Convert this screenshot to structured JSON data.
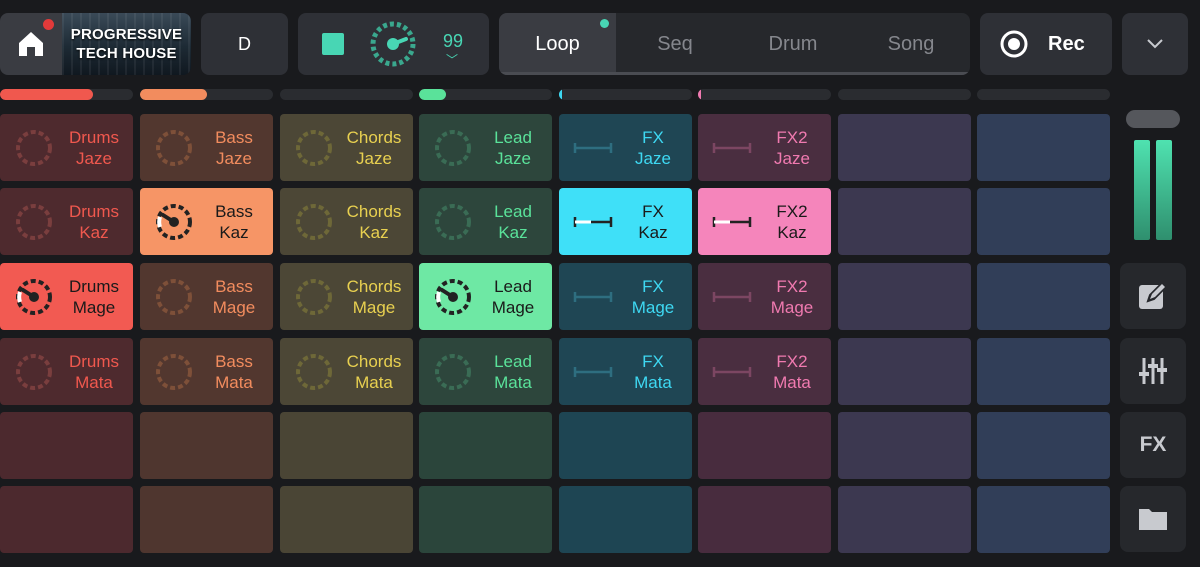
{
  "project": {
    "title_line1": "PROGRESSIVE",
    "title_line2": "TECH HOUSE"
  },
  "key": "D",
  "tempo": {
    "value": "99"
  },
  "tabs": [
    {
      "label": "Loop",
      "active": true
    },
    {
      "label": "Seq",
      "active": false
    },
    {
      "label": "Drum",
      "active": false
    },
    {
      "label": "Song",
      "active": false
    }
  ],
  "record": {
    "label": "Rec"
  },
  "sidebar": {
    "fx_label": "FX"
  },
  "lanes": [
    {
      "color": "#f0584e",
      "progress": 0.7
    },
    {
      "color": "#f28c5e",
      "progress": 0.5
    },
    {
      "color": "#d9c24a",
      "progress": 0
    },
    {
      "color": "#5ae29a",
      "progress": 0.2
    },
    {
      "color": "#3ed8f2",
      "progress": 0.01
    },
    {
      "color": "#f07ab0",
      "progress": 0.01
    },
    {
      "color": "#8a7ac8",
      "progress": 0
    },
    {
      "color": "#6a8ec8",
      "progress": 0
    }
  ],
  "columns": [
    {
      "name": "Drums",
      "icon": "dial",
      "color": "#f0584e",
      "idle_bg": "#4e2a2e",
      "empty_bg": "#4c292e",
      "text": "#f0584e",
      "icon_color": "#7a3e3e",
      "active_bg": "#f25a52"
    },
    {
      "name": "Bass",
      "icon": "dial",
      "color": "#f28c5e",
      "idle_bg": "#52372f",
      "empty_bg": "#4f362f",
      "text": "#f28c5e",
      "icon_color": "#7e5039",
      "active_bg": "#f69566"
    },
    {
      "name": "Chords",
      "icon": "dial",
      "color": "#d9c24a",
      "idle_bg": "#4c4736",
      "empty_bg": "#4a4535",
      "text": "#e8d050",
      "icon_color": "#6e6838",
      "active_bg": "#e5cf55"
    },
    {
      "name": "Lead",
      "icon": "dial",
      "color": "#5ae29a",
      "idle_bg": "#2d463c",
      "empty_bg": "#2b453b",
      "text": "#5ae29a",
      "icon_color": "#3a6c55",
      "active_bg": "#6ee8a4"
    },
    {
      "name": "FX",
      "icon": "fader",
      "color": "#3ed8f2",
      "idle_bg": "#1f4654",
      "empty_bg": "#1e4553",
      "text": "#3ed8f2",
      "icon_color": "#2e6e80",
      "active_bg": "#3fe0f8"
    },
    {
      "name": "FX2",
      "icon": "fader",
      "color": "#f07ab0",
      "idle_bg": "#4a2e40",
      "empty_bg": "#482c3e",
      "text": "#f07ab0",
      "icon_color": "#7c4662",
      "active_bg": "#f585bb"
    },
    {
      "name": "",
      "icon": "none",
      "idle_bg": "#3e3a52",
      "empty_bg": "#3c3850"
    },
    {
      "name": "",
      "icon": "none",
      "idle_bg": "#33405a",
      "empty_bg": "#313e58"
    }
  ],
  "rows": [
    "Jaze",
    "Kaz",
    "Mage",
    "Mata",
    "",
    ""
  ],
  "active_cells": [
    {
      "col": 0,
      "row": 2
    },
    {
      "col": 1,
      "row": 1
    },
    {
      "col": 3,
      "row": 2
    },
    {
      "col": 4,
      "row": 1
    },
    {
      "col": 5,
      "row": 1
    }
  ]
}
